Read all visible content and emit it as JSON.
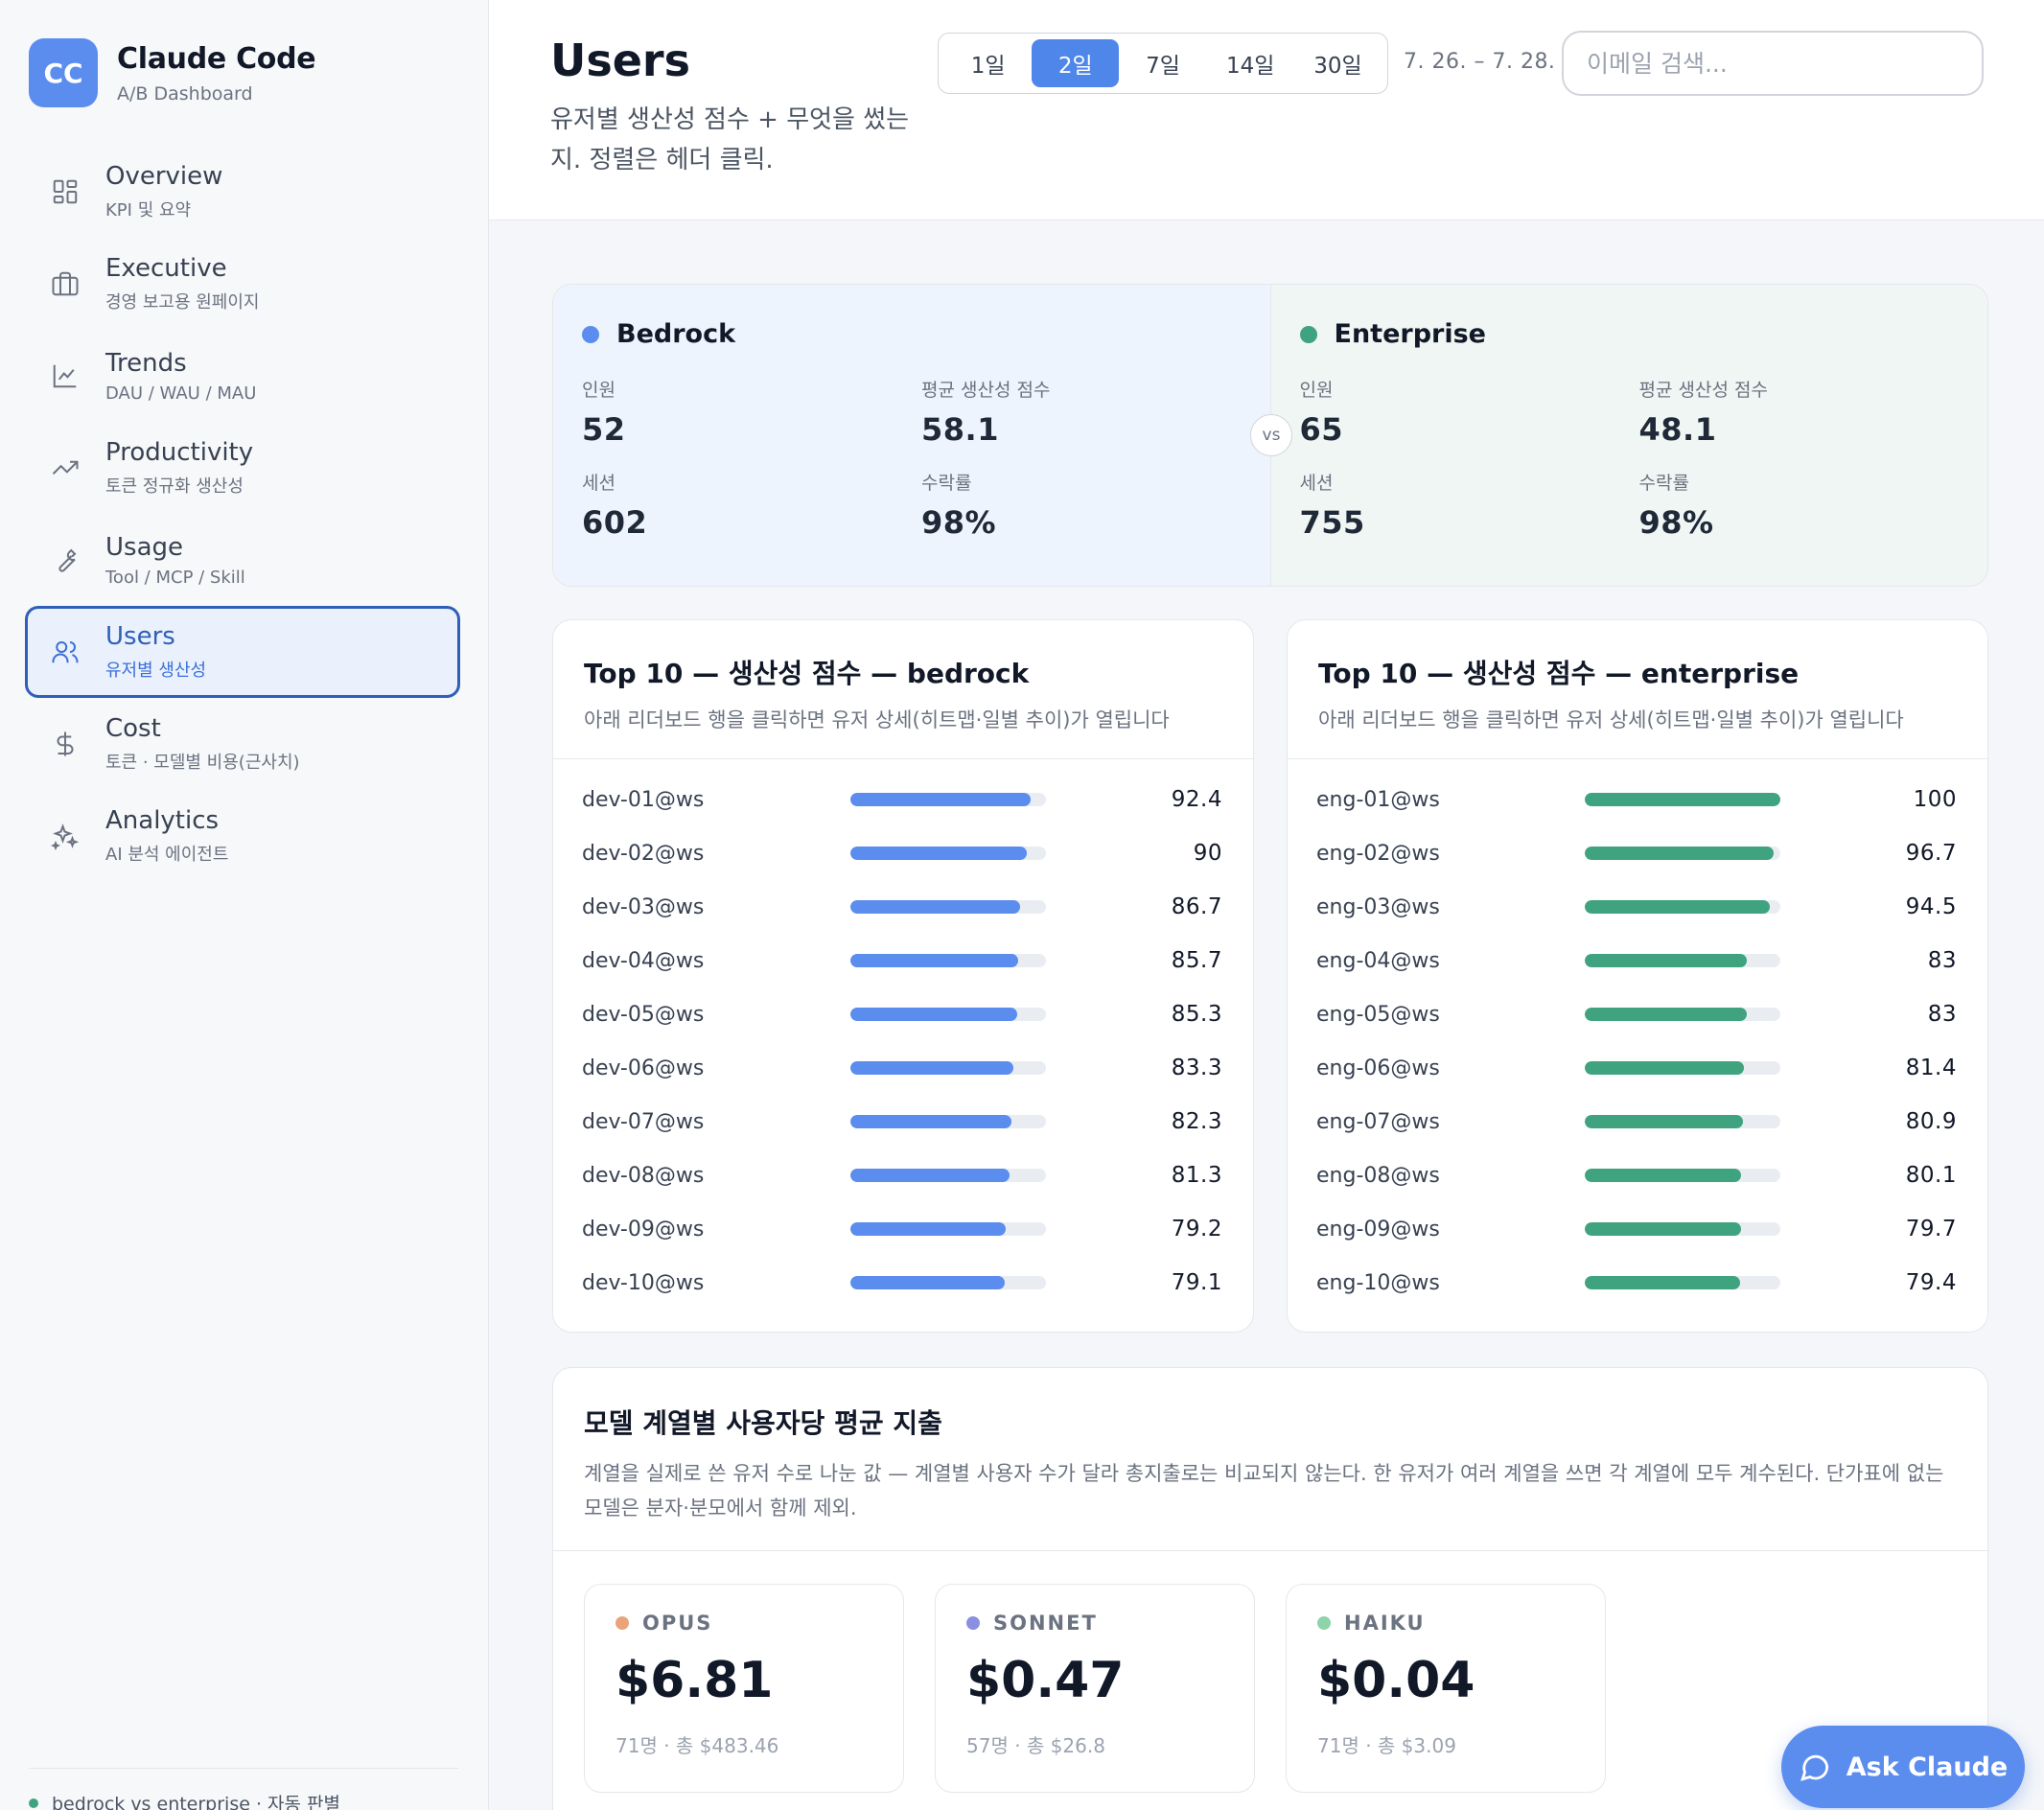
{
  "brand": {
    "logo": "CC",
    "title": "Claude Code",
    "subtitle": "A/B Dashboard"
  },
  "nav": [
    {
      "label": "Overview",
      "desc": "KPI 및 요약",
      "icon": "grid-icon"
    },
    {
      "label": "Executive",
      "desc": "경영 보고용 원페이지",
      "icon": "briefcase-icon"
    },
    {
      "label": "Trends",
      "desc": "DAU / WAU / MAU",
      "icon": "line-chart-icon"
    },
    {
      "label": "Productivity",
      "desc": "토큰 정규화 생산성",
      "icon": "trending-up-icon"
    },
    {
      "label": "Usage",
      "desc": "Tool / MCP / Skill",
      "icon": "wrench-icon"
    },
    {
      "label": "Users",
      "desc": "유저별 생산성",
      "icon": "users-icon",
      "active": true
    },
    {
      "label": "Cost",
      "desc": "토큰 · 모델별 비용(근사치)",
      "icon": "dollar-icon"
    },
    {
      "label": "Analytics",
      "desc": "AI 분석 에이전트",
      "icon": "sparkles-icon"
    }
  ],
  "sidebar_footer": "bedrock vs enterprise · 자동 판별",
  "header": {
    "title": "Users",
    "description": "유저별 생산성 점수 + 무엇을 썼는지. 정렬은 헤더 클릭.",
    "ranges": [
      "1일",
      "2일",
      "7일",
      "14일",
      "30일"
    ],
    "active_range": "2일",
    "date_range": "7. 26. – 7. 28.",
    "search_placeholder": "이메일 검색..."
  },
  "comparison": {
    "vs": "vs",
    "groups": [
      {
        "name": "Bedrock",
        "color": "#5b8def",
        "metrics": [
          {
            "label": "인원",
            "value": "52"
          },
          {
            "label": "평균 생산성 점수",
            "value": "58.1"
          },
          {
            "label": "세션",
            "value": "602"
          },
          {
            "label": "수락률",
            "value": "98%"
          }
        ]
      },
      {
        "name": "Enterprise",
        "color": "#3fa37f",
        "metrics": [
          {
            "label": "인원",
            "value": "65"
          },
          {
            "label": "평균 생산성 점수",
            "value": "48.1"
          },
          {
            "label": "세션",
            "value": "755"
          },
          {
            "label": "수락률",
            "value": "98%"
          }
        ]
      }
    ]
  },
  "leaderboards": [
    {
      "title": "Top 10 — 생산성 점수 — bedrock",
      "subtitle": "아래 리더보드 행을 클릭하면 유저 상세(히트맵·일별 추이)가 열립니다",
      "color": "#5b8def",
      "rows": [
        {
          "user": "dev-01@ws",
          "score": "92.4",
          "fill": 0.924
        },
        {
          "user": "dev-02@ws",
          "score": "90",
          "fill": 0.9
        },
        {
          "user": "dev-03@ws",
          "score": "86.7",
          "fill": 0.867
        },
        {
          "user": "dev-04@ws",
          "score": "85.7",
          "fill": 0.857
        },
        {
          "user": "dev-05@ws",
          "score": "85.3",
          "fill": 0.853
        },
        {
          "user": "dev-06@ws",
          "score": "83.3",
          "fill": 0.833
        },
        {
          "user": "dev-07@ws",
          "score": "82.3",
          "fill": 0.823
        },
        {
          "user": "dev-08@ws",
          "score": "81.3",
          "fill": 0.813
        },
        {
          "user": "dev-09@ws",
          "score": "79.2",
          "fill": 0.792
        },
        {
          "user": "dev-10@ws",
          "score": "79.1",
          "fill": 0.791
        }
      ]
    },
    {
      "title": "Top 10 — 생산성 점수 — enterprise",
      "subtitle": "아래 리더보드 행을 클릭하면 유저 상세(히트맵·일별 추이)가 열립니다",
      "color": "#3fa37f",
      "rows": [
        {
          "user": "eng-01@ws",
          "score": "100",
          "fill": 1.0
        },
        {
          "user": "eng-02@ws",
          "score": "96.7",
          "fill": 0.967
        },
        {
          "user": "eng-03@ws",
          "score": "94.5",
          "fill": 0.945
        },
        {
          "user": "eng-04@ws",
          "score": "83",
          "fill": 0.83
        },
        {
          "user": "eng-05@ws",
          "score": "83",
          "fill": 0.83
        },
        {
          "user": "eng-06@ws",
          "score": "81.4",
          "fill": 0.814
        },
        {
          "user": "eng-07@ws",
          "score": "80.9",
          "fill": 0.809
        },
        {
          "user": "eng-08@ws",
          "score": "80.1",
          "fill": 0.801
        },
        {
          "user": "eng-09@ws",
          "score": "79.7",
          "fill": 0.797
        },
        {
          "user": "eng-10@ws",
          "score": "79.4",
          "fill": 0.794
        }
      ]
    }
  ],
  "model_cost": {
    "title": "모델 계열별 사용자당 평균 지출",
    "description": "계열을 실제로 쓴 유저 수로 나눈 값 — 계열별 사용자 수가 달라 총지출로는 비교되지 않는다. 한 유저가 여러 계열을 쓰면 각 계열에 모두 계수된다. 단가표에 없는 모델은 분자·분모에서 함께 제외.",
    "models": [
      {
        "name": "OPUS",
        "value": "$6.81",
        "meta": "71명 · 총 $483.46",
        "color": "#e8a57b"
      },
      {
        "name": "SONNET",
        "value": "$0.47",
        "meta": "57명 · 총 $26.8",
        "color": "#8b8fe0"
      },
      {
        "name": "HAIKU",
        "value": "$0.04",
        "meta": "71명 · 총 $3.09",
        "color": "#8fd3aa"
      }
    ]
  },
  "ask_button": "Ask Claude"
}
